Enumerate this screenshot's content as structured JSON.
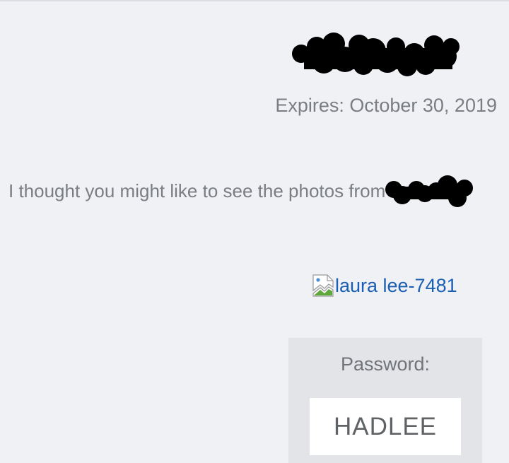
{
  "header": {
    "expires_text": "Expires: October 30, 2019"
  },
  "message": {
    "text": "I thought you might like to see the photos from"
  },
  "photo": {
    "alt_text": "laura lee-7481",
    "icon": "broken-image-icon"
  },
  "password": {
    "label": "Password:",
    "value": "HADLEE"
  },
  "colors": {
    "background": "#f0f1f5",
    "text": "#7a7d82",
    "link": "#1a5fb4",
    "password_box": "#e3e4e7",
    "redaction": "#000000"
  }
}
